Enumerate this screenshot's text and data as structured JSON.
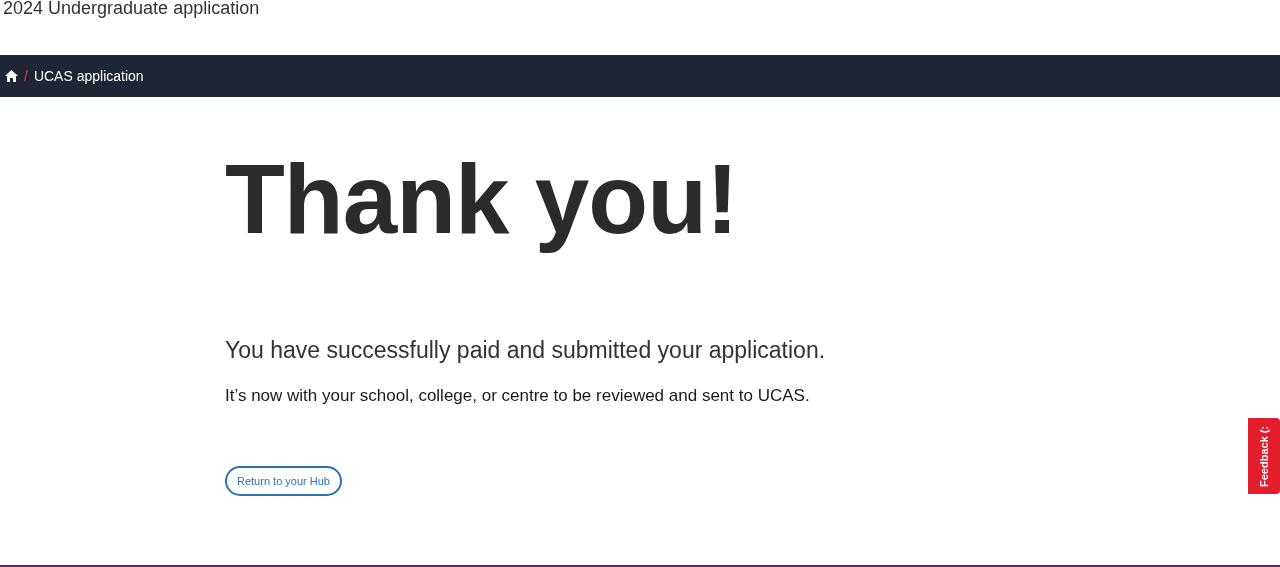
{
  "page_title": "2024 Undergraduate application",
  "breadcrumb": [
    {
      "separator": "/",
      "label": "UCAS application"
    }
  ],
  "heading": "Thank you!",
  "lead": "You have successfully paid and submitted your application.",
  "body": "It’s now with your school, college, or centre to be reviewed and sent to UCAS.",
  "button": "Return to your Hub",
  "feedback_tab": "Feedback (:"
}
